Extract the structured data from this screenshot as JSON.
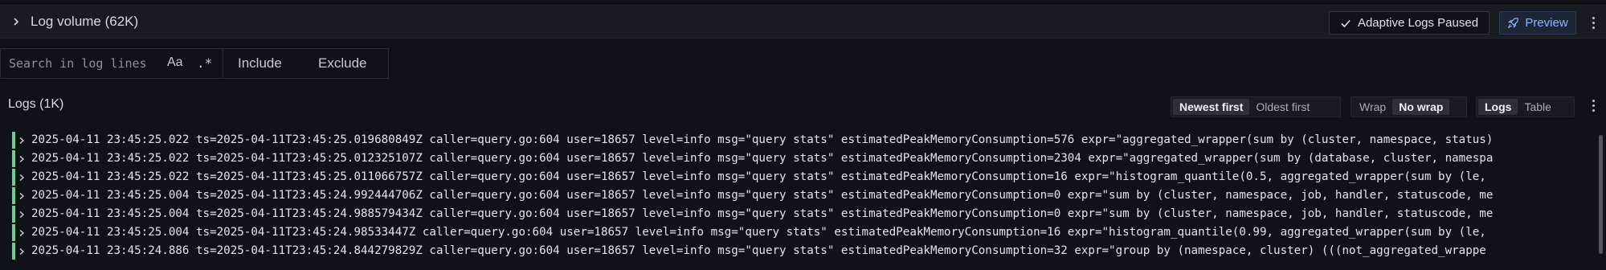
{
  "log_volume": {
    "title": "Log volume (62K)",
    "adaptive_label": "Adaptive Logs Paused",
    "preview_label": "Preview"
  },
  "search": {
    "placeholder": "Search in log lines",
    "case_option": "Aa",
    "regex_option": ".*",
    "include_label": "Include",
    "exclude_label": "Exclude"
  },
  "logs": {
    "title": "Logs (1K)",
    "sort_options": [
      "Newest first",
      "Oldest first"
    ],
    "sort_selected": "Newest first",
    "wrap_options": [
      "Wrap",
      "No wrap"
    ],
    "wrap_selected": "No wrap",
    "view_options": [
      "Logs",
      "Table"
    ],
    "view_selected": "Logs",
    "level_color": "#6ccf8e",
    "lines": [
      "2025-04-11 23:45:25.022 ts=2025-04-11T23:45:25.019680849Z caller=query.go:604 user=18657 level=info msg=\"query stats\" estimatedPeakMemoryConsumption=576 expr=\"aggregated_wrapper(sum by (cluster, namespace, status)",
      "2025-04-11 23:45:25.022 ts=2025-04-11T23:45:25.012325107Z caller=query.go:604 user=18657 level=info msg=\"query stats\" estimatedPeakMemoryConsumption=2304 expr=\"aggregated_wrapper(sum by (database, cluster, namespa",
      "2025-04-11 23:45:25.022 ts=2025-04-11T23:45:25.011066757Z caller=query.go:604 user=18657 level=info msg=\"query stats\" estimatedPeakMemoryConsumption=16 expr=\"histogram_quantile(0.5, aggregated_wrapper(sum by (le,",
      "2025-04-11 23:45:25.004 ts=2025-04-11T23:45:24.992444706Z caller=query.go:604 user=18657 level=info msg=\"query stats\" estimatedPeakMemoryConsumption=0 expr=\"sum by (cluster, namespace, job, handler, statuscode, me",
      "2025-04-11 23:45:25.004 ts=2025-04-11T23:45:24.988579434Z caller=query.go:604 user=18657 level=info msg=\"query stats\" estimatedPeakMemoryConsumption=0 expr=\"sum by (cluster, namespace, job, handler, statuscode, me",
      "2025-04-11 23:45:25.004 ts=2025-04-11T23:45:24.98533447Z caller=query.go:604 user=18657 level=info msg=\"query stats\" estimatedPeakMemoryConsumption=16 expr=\"histogram_quantile(0.99, aggregated_wrapper(sum by (le,",
      "2025-04-11 23:45:24.886 ts=2025-04-11T23:45:24.844279829Z caller=query.go:604 user=18657 level=info msg=\"query stats\" estimatedPeakMemoryConsumption=32 expr=\"group by (namespace, cluster) (((not_aggregated_wrappe"
    ]
  }
}
